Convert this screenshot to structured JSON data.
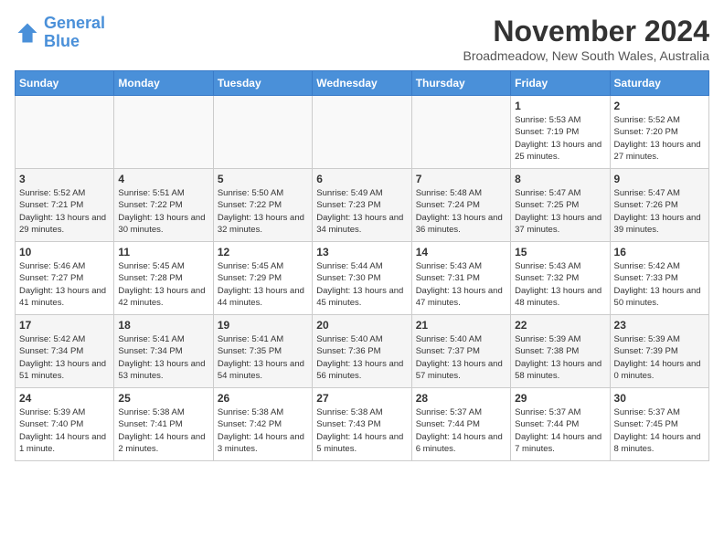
{
  "logo": {
    "line1": "General",
    "line2": "Blue"
  },
  "title": "November 2024",
  "subtitle": "Broadmeadow, New South Wales, Australia",
  "days_of_week": [
    "Sunday",
    "Monday",
    "Tuesday",
    "Wednesday",
    "Thursday",
    "Friday",
    "Saturday"
  ],
  "weeks": [
    [
      {
        "day": null
      },
      {
        "day": null
      },
      {
        "day": null
      },
      {
        "day": null
      },
      {
        "day": null
      },
      {
        "day": 1,
        "sunrise": "5:53 AM",
        "sunset": "7:19 PM",
        "daylight": "13 hours and 25 minutes."
      },
      {
        "day": 2,
        "sunrise": "5:52 AM",
        "sunset": "7:20 PM",
        "daylight": "13 hours and 27 minutes."
      }
    ],
    [
      {
        "day": 3,
        "sunrise": "5:52 AM",
        "sunset": "7:21 PM",
        "daylight": "13 hours and 29 minutes."
      },
      {
        "day": 4,
        "sunrise": "5:51 AM",
        "sunset": "7:22 PM",
        "daylight": "13 hours and 30 minutes."
      },
      {
        "day": 5,
        "sunrise": "5:50 AM",
        "sunset": "7:22 PM",
        "daylight": "13 hours and 32 minutes."
      },
      {
        "day": 6,
        "sunrise": "5:49 AM",
        "sunset": "7:23 PM",
        "daylight": "13 hours and 34 minutes."
      },
      {
        "day": 7,
        "sunrise": "5:48 AM",
        "sunset": "7:24 PM",
        "daylight": "13 hours and 36 minutes."
      },
      {
        "day": 8,
        "sunrise": "5:47 AM",
        "sunset": "7:25 PM",
        "daylight": "13 hours and 37 minutes."
      },
      {
        "day": 9,
        "sunrise": "5:47 AM",
        "sunset": "7:26 PM",
        "daylight": "13 hours and 39 minutes."
      }
    ],
    [
      {
        "day": 10,
        "sunrise": "5:46 AM",
        "sunset": "7:27 PM",
        "daylight": "13 hours and 41 minutes."
      },
      {
        "day": 11,
        "sunrise": "5:45 AM",
        "sunset": "7:28 PM",
        "daylight": "13 hours and 42 minutes."
      },
      {
        "day": 12,
        "sunrise": "5:45 AM",
        "sunset": "7:29 PM",
        "daylight": "13 hours and 44 minutes."
      },
      {
        "day": 13,
        "sunrise": "5:44 AM",
        "sunset": "7:30 PM",
        "daylight": "13 hours and 45 minutes."
      },
      {
        "day": 14,
        "sunrise": "5:43 AM",
        "sunset": "7:31 PM",
        "daylight": "13 hours and 47 minutes."
      },
      {
        "day": 15,
        "sunrise": "5:43 AM",
        "sunset": "7:32 PM",
        "daylight": "13 hours and 48 minutes."
      },
      {
        "day": 16,
        "sunrise": "5:42 AM",
        "sunset": "7:33 PM",
        "daylight": "13 hours and 50 minutes."
      }
    ],
    [
      {
        "day": 17,
        "sunrise": "5:42 AM",
        "sunset": "7:34 PM",
        "daylight": "13 hours and 51 minutes."
      },
      {
        "day": 18,
        "sunrise": "5:41 AM",
        "sunset": "7:34 PM",
        "daylight": "13 hours and 53 minutes."
      },
      {
        "day": 19,
        "sunrise": "5:41 AM",
        "sunset": "7:35 PM",
        "daylight": "13 hours and 54 minutes."
      },
      {
        "day": 20,
        "sunrise": "5:40 AM",
        "sunset": "7:36 PM",
        "daylight": "13 hours and 56 minutes."
      },
      {
        "day": 21,
        "sunrise": "5:40 AM",
        "sunset": "7:37 PM",
        "daylight": "13 hours and 57 minutes."
      },
      {
        "day": 22,
        "sunrise": "5:39 AM",
        "sunset": "7:38 PM",
        "daylight": "13 hours and 58 minutes."
      },
      {
        "day": 23,
        "sunrise": "5:39 AM",
        "sunset": "7:39 PM",
        "daylight": "14 hours and 0 minutes."
      }
    ],
    [
      {
        "day": 24,
        "sunrise": "5:39 AM",
        "sunset": "7:40 PM",
        "daylight": "14 hours and 1 minute."
      },
      {
        "day": 25,
        "sunrise": "5:38 AM",
        "sunset": "7:41 PM",
        "daylight": "14 hours and 2 minutes."
      },
      {
        "day": 26,
        "sunrise": "5:38 AM",
        "sunset": "7:42 PM",
        "daylight": "14 hours and 3 minutes."
      },
      {
        "day": 27,
        "sunrise": "5:38 AM",
        "sunset": "7:43 PM",
        "daylight": "14 hours and 5 minutes."
      },
      {
        "day": 28,
        "sunrise": "5:37 AM",
        "sunset": "7:44 PM",
        "daylight": "14 hours and 6 minutes."
      },
      {
        "day": 29,
        "sunrise": "5:37 AM",
        "sunset": "7:44 PM",
        "daylight": "14 hours and 7 minutes."
      },
      {
        "day": 30,
        "sunrise": "5:37 AM",
        "sunset": "7:45 PM",
        "daylight": "14 hours and 8 minutes."
      }
    ]
  ]
}
